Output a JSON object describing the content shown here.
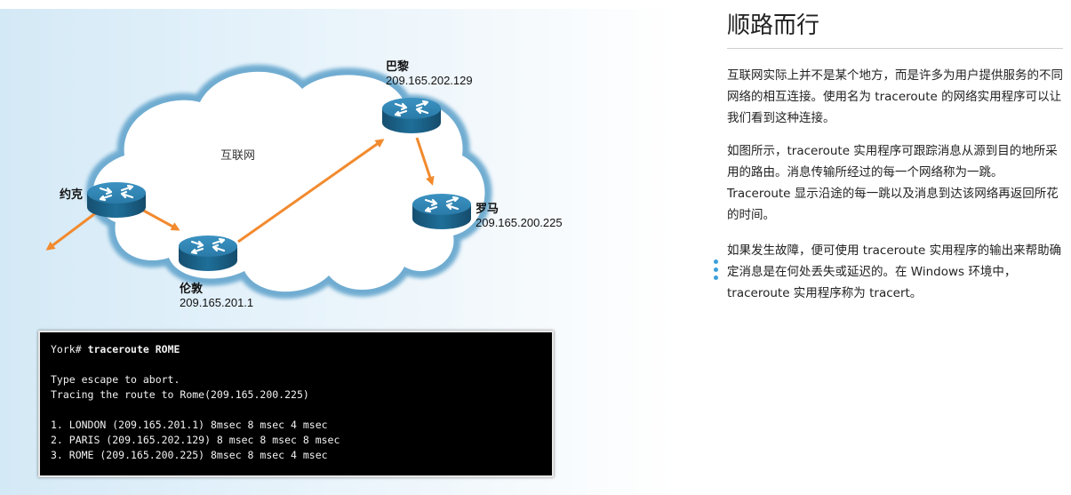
{
  "diagram": {
    "cloud_label": "互联网",
    "nodes": {
      "york": {
        "name": "约克"
      },
      "london": {
        "name": "伦敦",
        "ip": "209.165.201.1"
      },
      "paris": {
        "name": "巴黎",
        "ip": "209.165.202.129"
      },
      "rome": {
        "name": "罗马",
        "ip": "209.165.200.225"
      }
    },
    "colors": {
      "router": "#1e6f99",
      "arrow": "#f28a2e",
      "cloud": "#6aa9cf"
    }
  },
  "terminal": {
    "prompt": "York#",
    "command": "traceroute ROME",
    "lines_intro": [
      "Type escape to abort.",
      "Tracing the route to Rome(209.165.200.225)"
    ],
    "hops": [
      "1. LONDON (209.165.201.1) 8msec 8 msec 4 msec",
      "2. PARIS (209.165.202.129) 8 msec 8 msec 8 msec",
      "3. ROME (209.165.200.225) 8msec 8 msec 4 msec"
    ]
  },
  "panel": {
    "title": "顺路而行",
    "paragraphs": [
      "互联网实际上并不是某个地方，而是许多为用户提供服务的不同网络的相互连接。使用名为 traceroute 的网络实用程序可以让我们看到这种连接。",
      "如图所示，traceroute 实用程序可跟踪消息从源到目的地所采用的路由。消息传输所经过的每一个网络称为一跳。Traceroute 显示沿途的每一跳以及消息到达该网络再返回所花的时间。",
      "如果发生故障，便可使用 traceroute 实用程序的输出来帮助确定消息是在何处丢失或延迟的。在 Windows 环境中，traceroute 实用程序称为 tracert。"
    ]
  }
}
